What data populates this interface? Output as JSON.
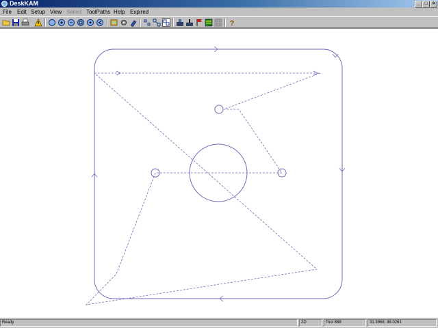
{
  "window": {
    "title": "DeskKAM"
  },
  "menu": [
    "File",
    "Edit",
    "Setup",
    "View",
    "Select",
    "ToolPaths",
    "Help",
    "Expired"
  ],
  "menu_disabled": [
    "Select"
  ],
  "toolbar_icons": [
    "open-folder-icon",
    "save-icon",
    "print-icon",
    "warning-icon",
    "zoom-icon",
    "zoom-in-icon",
    "zoom-out-icon",
    "zoom-window-icon",
    "zoom-extents-icon",
    "zoom-previous-icon",
    "layers-icon",
    "settings-icon",
    "tool-icon",
    "points-icon",
    "select-nodes-icon",
    "select-objects-icon",
    "machine-icon",
    "drill-icon",
    "flag-icon",
    "color-icon",
    "grid-icon",
    "help-icon"
  ],
  "status": {
    "message": "Ready",
    "mode": "2D",
    "tool": "Tool 888",
    "coordinates": "31.3968, 88.0261"
  },
  "colors": {
    "toolpath": "#6b6bb8",
    "rapid": "#6b6bb8"
  }
}
